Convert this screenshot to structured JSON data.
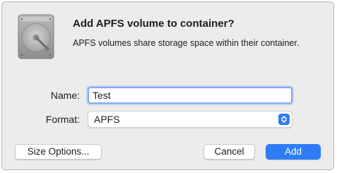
{
  "dialog": {
    "icon": "hard-disk-icon",
    "title": "Add APFS volume to container?",
    "message": "APFS volumes share storage space within their container."
  },
  "form": {
    "name_label": "Name:",
    "name_value": "Test",
    "format_label": "Format:",
    "format_value": "APFS"
  },
  "buttons": {
    "size_options": "Size Options...",
    "cancel": "Cancel",
    "add": "Add"
  },
  "colors": {
    "accent": "#2d7cf6",
    "dialog_background": "#ececec",
    "focus_ring": "#7faaf2"
  }
}
